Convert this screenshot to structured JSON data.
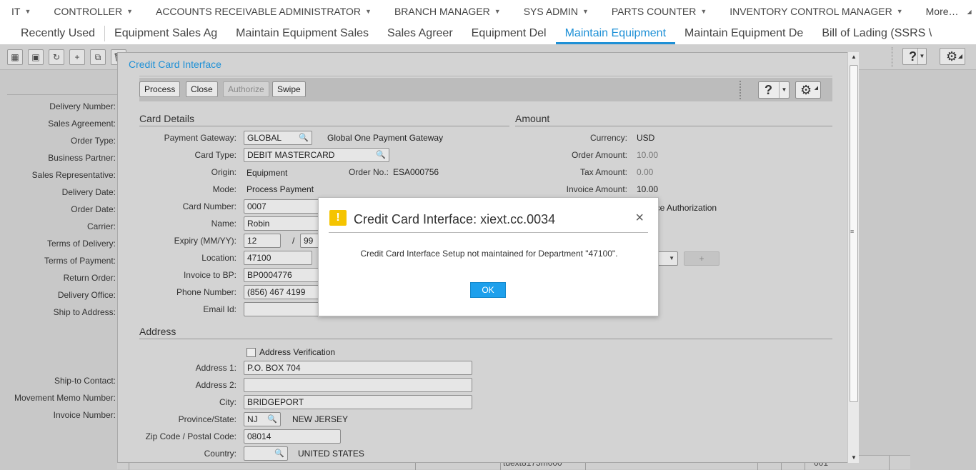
{
  "roles": [
    "IT",
    "CONTROLLER",
    "ACCOUNTS RECEIVABLE ADMINISTRATOR",
    "BRANCH MANAGER",
    "SYS ADMIN",
    "PARTS COUNTER",
    "INVENTORY CONTROL MANAGER"
  ],
  "roles_more": "More…",
  "tabs": [
    "Recently Used",
    "Equipment Sales Ag",
    "Maintain Equipment Sales",
    "Sales Agreer",
    "Equipment Del",
    "Maintain Equipment",
    "Maintain Equipment De",
    "Bill of Lading (SSRS \\"
  ],
  "active_tab_index": 5,
  "background_labels": [
    "Delivery Number:",
    "Sales Agreement:",
    "Order Type:",
    "Business Partner:",
    "Sales Representative:",
    "Delivery Date:",
    "Order Date:",
    "Carrier:",
    "Terms of Delivery:",
    "Terms of Payment:",
    "Return Order:",
    "Delivery Office:",
    "Ship to Address:",
    "Ship-to Contact:",
    "Movement Memo Number:",
    "Invoice Number:"
  ],
  "background_bottom": {
    "session": "tdext8175m000",
    "value": "001"
  },
  "cc": {
    "title": "Credit Card Interface",
    "toolbar": {
      "process": "Process",
      "close": "Close",
      "authorize": "Authorize",
      "swipe": "Swipe",
      "help": "?"
    },
    "card_details": {
      "heading": "Card Details",
      "payment_gateway_label": "Payment Gateway:",
      "payment_gateway": "GLOBAL",
      "payment_gateway_desc": "Global One Payment Gateway",
      "card_type_label": "Card Type:",
      "card_type": "DEBIT MASTERCARD",
      "origin_label": "Origin:",
      "origin": "Equipment",
      "order_no_label": "Order No.:",
      "order_no": "ESA000756",
      "mode_label": "Mode:",
      "mode": "Process Payment",
      "card_number_label": "Card Number:",
      "card_number": "0007",
      "name_label": "Name:",
      "name": "Robin",
      "expiry_label": "Expiry (MM/YY):",
      "expiry_mm": "12",
      "expiry_sep": "/",
      "expiry_yy": "99",
      "location_label": "Location:",
      "location": "47100",
      "invoice_bp_label": "Invoice to BP:",
      "invoice_bp": "BP0004776",
      "phone_label": "Phone Number:",
      "phone": "(856) 467 4199",
      "email_label": "Email Id:",
      "email": ""
    },
    "amount": {
      "heading": "Amount",
      "currency_label": "Currency:",
      "currency": "USD",
      "order_amount_label": "Order Amount:",
      "order_amount": "10.00",
      "tax_amount_label": "Tax Amount:",
      "tax_amount": "0.00",
      "invoice_amount_label": "Invoice Amount:",
      "invoice_amount": "10.00",
      "partial_text": "ice Authorization",
      "plus": "+"
    },
    "address": {
      "heading": "Address",
      "verification": "Address Verification",
      "address1_label": "Address 1:",
      "address1": "P.O. BOX 704",
      "address2_label": "Address 2:",
      "address2": "",
      "city_label": "City:",
      "city": "BRIDGEPORT",
      "province_label": "Province/State:",
      "province": "NJ",
      "province_desc": "NEW JERSEY",
      "zip_label": "Zip Code / Postal Code:",
      "zip": "08014",
      "country_label": "Country:",
      "country": "",
      "country_desc": "UNITED STATES"
    }
  },
  "dialog": {
    "title": "Credit Card Interface: xiext.cc.0034",
    "message": "Credit Card Interface Setup not maintained for Department \"47100\".",
    "ok": "OK",
    "close": "×",
    "icon": "!"
  }
}
